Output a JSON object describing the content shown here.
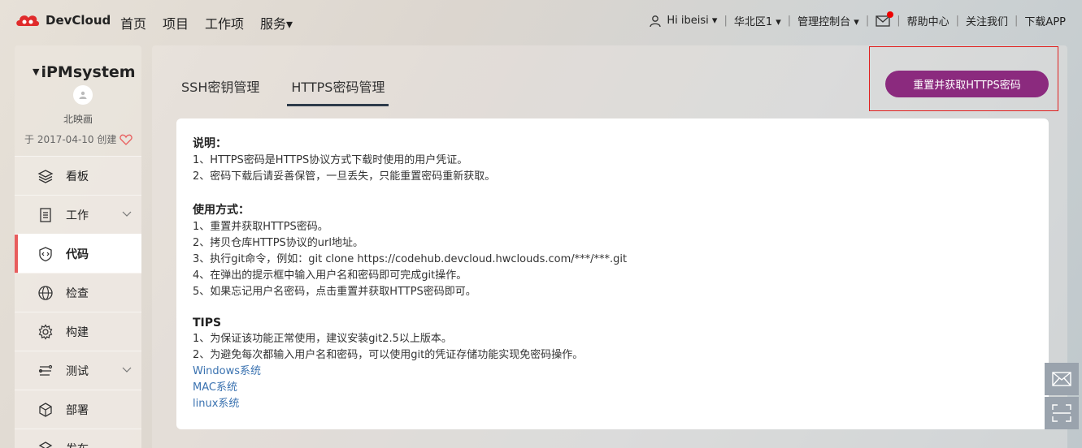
{
  "brand": {
    "name": "DevCloud",
    "color": "#e02b2b"
  },
  "nav": {
    "items": [
      "首页",
      "项目",
      "工作项",
      "服务▾"
    ]
  },
  "nav_right": {
    "user": "Hi ibeisi ▾",
    "region": "华北区1 ▾",
    "console": "管理控制台 ▾",
    "help": "帮助中心",
    "follow": "关注我们",
    "download": "下载APP"
  },
  "project": {
    "name": "iPMsystem",
    "owner": "北映画",
    "created": "于 2017-04-10 创建"
  },
  "menu": [
    {
      "label": "看板",
      "icon": "layers-icon",
      "has_chevron": false
    },
    {
      "label": "工作",
      "icon": "list-icon",
      "has_chevron": true
    },
    {
      "label": "代码",
      "icon": "code-icon",
      "has_chevron": false,
      "active": true
    },
    {
      "label": "检查",
      "icon": "globe-check-icon",
      "has_chevron": false
    },
    {
      "label": "构建",
      "icon": "gear-icon",
      "has_chevron": false
    },
    {
      "label": "测试",
      "icon": "test-icon",
      "has_chevron": true
    },
    {
      "label": "部署",
      "icon": "cube-icon",
      "has_chevron": false
    },
    {
      "label": "发布",
      "icon": "release-icon",
      "has_chevron": false
    }
  ],
  "tabs": {
    "ssh": "SSH密钥管理",
    "https": "HTTPS密码管理"
  },
  "reset_button": "重置并获取HTTPS密码",
  "content": {
    "desc_title": "说明：",
    "desc": [
      "1、HTTPS密码是HTTPS协议方式下载时使用的用户凭证。",
      "2、密码下载后请妥善保管，一旦丢失，只能重置密码重新获取。"
    ],
    "usage_title": "使用方式：",
    "usage": [
      "1、重置并获取HTTPS密码。",
      "2、拷贝仓库HTTPS协议的url地址。",
      "3、执行git命令，例如：git clone https://codehub.devcloud.hwclouds.com/***/***.git",
      "4、在弹出的提示框中输入用户名和密码即可完成git操作。",
      "5、如果忘记用户名密码，点击重置并获取HTTPS密码即可。"
    ],
    "tips_title": "TIPS",
    "tips": [
      "1、为保证该功能正常使用，建议安装git2.5以上版本。",
      "2、为避免每次都输入用户名和密码，可以使用git的凭证存储功能实现免密码操作。"
    ],
    "links": [
      "Windows系统",
      "MAC系统",
      "linux系统"
    ]
  },
  "colors": {
    "accent": "#8b2a7e",
    "active_bar": "#e85d5d",
    "link": "#3a72b0",
    "highlight": "#e0201f"
  }
}
